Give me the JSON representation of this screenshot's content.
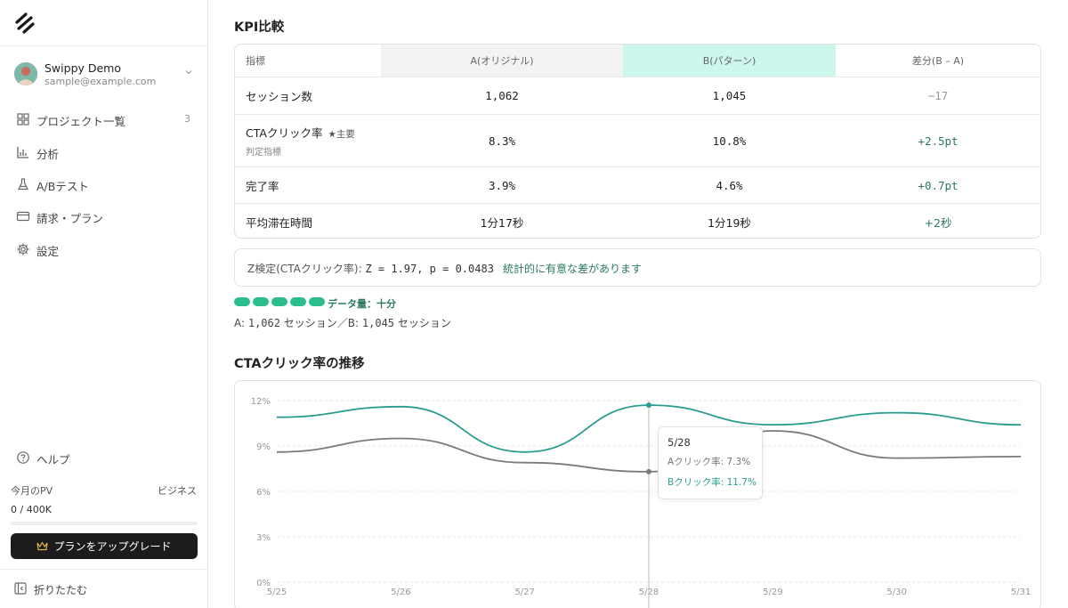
{
  "sidebar": {
    "user": {
      "name": "Swippy Demo",
      "email": "sample@example.com"
    },
    "nav": [
      {
        "label": "プロジェクト一覧",
        "count": "3",
        "icon": "grid-icon"
      },
      {
        "label": "分析",
        "count": "",
        "icon": "bar-chart-icon"
      },
      {
        "label": "A/Bテスト",
        "count": "",
        "icon": "flask-icon"
      },
      {
        "label": "請求・プラン",
        "count": "",
        "icon": "credit-card-icon"
      },
      {
        "label": "設定",
        "count": "",
        "icon": "gear-icon"
      },
      {
        "label": "ヘルプ",
        "count": "",
        "icon": "help-circle-icon"
      }
    ],
    "pv": {
      "label": "今月のPV",
      "plan": "ビジネス",
      "count": "0 / 400K",
      "progress": 0
    },
    "upgrade_label": "プランをアップグレード",
    "collapse_label": "折りたたむ"
  },
  "kpi": {
    "title": "KPI比較",
    "headers": [
      "指標",
      "A(オリジナル)",
      "B(パターン)",
      "差分(B – A)"
    ],
    "rows": [
      {
        "name": "セッション数",
        "badge": "",
        "note": "",
        "a": "1,062",
        "b": "1,045",
        "diff": "−17"
      },
      {
        "name": "CTAクリック率",
        "badge": "★主要",
        "note": "判定指標",
        "a": "8.3%",
        "b": "10.8%",
        "diff": "+2.5pt"
      },
      {
        "name": "完了率",
        "badge": "",
        "note": "",
        "a": "3.9%",
        "b": "4.6%",
        "diff": "+0.7pt"
      },
      {
        "name": "平均滞在時間",
        "badge": "",
        "note": "",
        "a": "1分17秒",
        "b": "1分19秒",
        "diff": "+2秒"
      }
    ]
  },
  "ztest": {
    "label": "Z検定(CTAクリック率): ",
    "value": "Z = 1.97, p = 0.0483",
    "result": "統計的に有意な差があります"
  },
  "data_amount": {
    "label": "データ量：十分",
    "level": 5,
    "max": 5
  },
  "sessions": {
    "prefix_a": "A: ",
    "a": "1,062",
    "mid": " セッション／B: ",
    "b": "1,045",
    "suffix": " セッション"
  },
  "chart_title": "CTAクリック率の推移",
  "chart_data": {
    "type": "line",
    "x": [
      "5/25",
      "5/26",
      "5/27",
      "5/28",
      "5/29",
      "5/30",
      "5/31"
    ],
    "yticks": [
      "0%",
      "3%",
      "6%",
      "9%",
      "12%"
    ],
    "ylim": [
      0,
      12
    ],
    "series": [
      {
        "name": "Aクリック率",
        "color": "#7a7a7e",
        "values": [
          8.6,
          9.5,
          7.9,
          7.3,
          10.0,
          8.2,
          8.3
        ]
      },
      {
        "name": "Bクリック率",
        "color": "#2a9d8f",
        "values": [
          10.9,
          11.6,
          8.6,
          11.7,
          10.4,
          11.2,
          10.4
        ]
      }
    ],
    "grid": true,
    "tooltip": {
      "date": "5/28",
      "a_label": "Aクリック率: 7.3%",
      "b_label": "Bクリック率: 11.7%"
    }
  },
  "colors": {
    "accent": "#2bbd8a",
    "positive": "#2c7a5b",
    "lineA": "#7a7a7e",
    "lineB": "#2a9d8f"
  }
}
